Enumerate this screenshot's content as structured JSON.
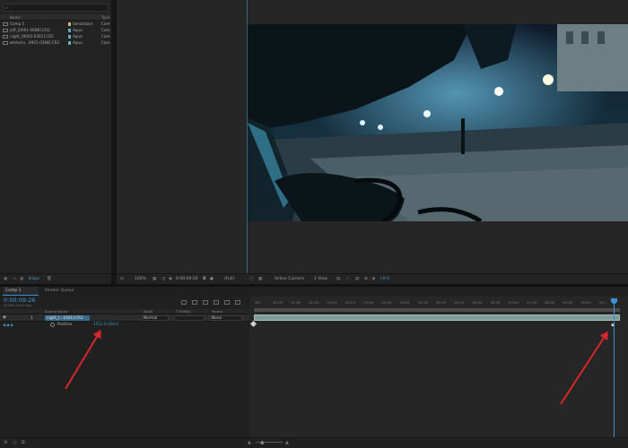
{
  "project": {
    "search_icon": "search-icon",
    "columns": {
      "name": "Name",
      "type": "Type"
    },
    "items": [
      {
        "name": "Comp 1",
        "label": "Sandstone",
        "type": "Com",
        "color": "#c8b48a"
      },
      {
        "name": "jeff_[0001-0688].CR2",
        "label": "Aqua",
        "type": "Cam",
        "color": "#5fb1b9"
      },
      {
        "name": "night_[0002-0301].CR2",
        "label": "Aqua",
        "type": "Cam",
        "color": "#5fb1b9"
      },
      {
        "name": "whiteria...0001-0398].CR2",
        "label": "Aqua",
        "type": "Cam",
        "color": "#5fb1b9"
      }
    ],
    "footer_bpc": "8 bpc"
  },
  "viewer_bar": {
    "zoom": "100%",
    "timecode": "0:00:09:26",
    "resolution": "(Full)",
    "camera": "Active Camera",
    "views": "1 View",
    "exposure": "+0.0"
  },
  "timeline": {
    "tabs": [
      "Comp 1",
      "Render Queue"
    ],
    "current_time": "0:00:09:26",
    "fps_info": "00296 (30.00 fps)",
    "columns": {
      "source_name": "Source Name",
      "mode": "Mode",
      "trkmat": "T TrkMat",
      "parent": "Parent"
    },
    "layer": {
      "number": "1",
      "name": "night_[...0301].CR2",
      "mode": "Normal",
      "parent": "None"
    },
    "property": {
      "name": "Position",
      "value": "1512.0,550.0"
    },
    "ruler": [
      "00f",
      "00:15f",
      "01:00f",
      "01:15f",
      "02:00f",
      "02:15f",
      "03:00f",
      "03:15f",
      "04:00f",
      "04:15f",
      "05:00f",
      "05:15f",
      "06:00f",
      "06:15f",
      "07:00f",
      "07:15f",
      "08:00f",
      "08:15f",
      "09:00f",
      "09:1"
    ],
    "playhead_progress": 0.985
  },
  "colors": {
    "accent": "#3f9fd8",
    "arrow": "#d8262b",
    "layer_bar": "#7e9c9a"
  }
}
